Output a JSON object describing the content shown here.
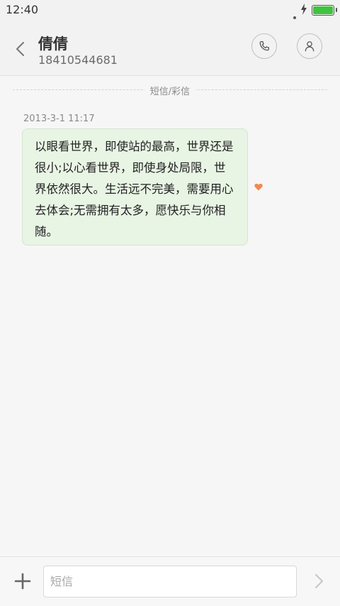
{
  "status_bar": {
    "time": "12:40"
  },
  "header": {
    "contact_name": "倩倩",
    "contact_number": "18410544681"
  },
  "conversation": {
    "divider_label": "短信/彩信",
    "messages": [
      {
        "timestamp": "2013-3-1 11:17",
        "text": "以眼看世界，即使站的最高，世界还是很小;以心看世界，即使身处局限，世界依然很大。生活远不完美，需要用心去体会;无需拥有太多，愿快乐与你相随。"
      }
    ]
  },
  "composer": {
    "placeholder": "短信"
  },
  "colors": {
    "bubble_bg": "#e8f4e4",
    "heart": "#f08a4b",
    "battery": "#3ec43e"
  },
  "icons": {
    "back": "chevron-left-icon",
    "call": "phone-icon",
    "profile": "person-icon",
    "favorite": "heart-icon",
    "add": "plus-icon",
    "send": "chevron-right-icon"
  }
}
